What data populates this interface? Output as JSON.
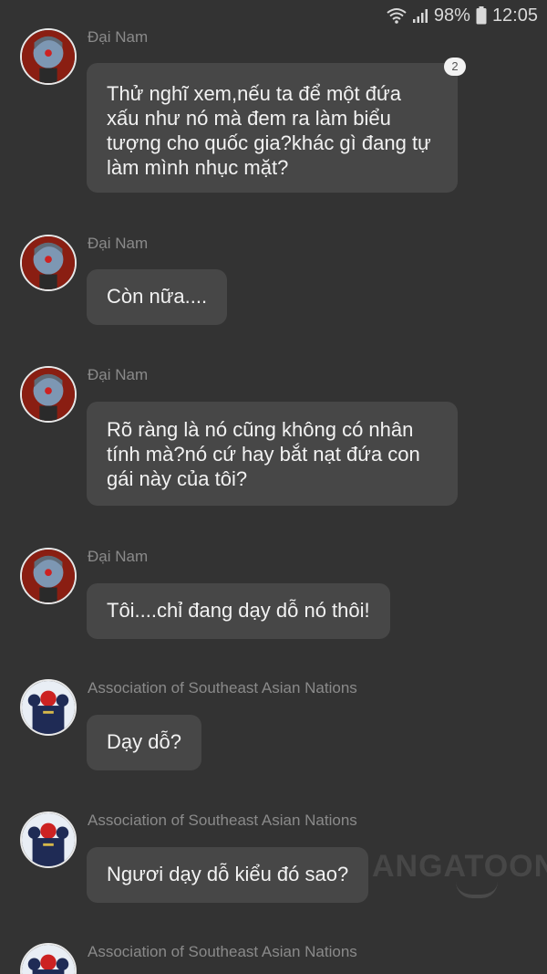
{
  "status_bar": {
    "battery": "98%",
    "time": "12:05",
    "wifi_icon": "wifi-icon",
    "signal_icon": "signal-icon",
    "battery_icon": "battery-icon"
  },
  "watermark": "ANGATOON",
  "messages": [
    {
      "sender": "Đại Nam",
      "avatar_icon": "dai-nam-avatar",
      "text": "Thử nghĩ xem,nếu ta để một đứa xấu như nó mà đem ra làm biểu tượng cho quốc gia?khác gì đang tự làm mình nhục mặt?",
      "badge": "2"
    },
    {
      "sender": "Đại Nam",
      "avatar_icon": "dai-nam-avatar",
      "text": "Còn nữa...."
    },
    {
      "sender": "Đại Nam",
      "avatar_icon": "dai-nam-avatar",
      "text": "Rõ ràng là nó cũng không có nhân tính mà?nó cứ hay bắt nạt đứa con gái này của tôi?"
    },
    {
      "sender": "Đại Nam",
      "avatar_icon": "dai-nam-avatar",
      "text": "Tôi....chỉ đang dạy dỗ nó thôi!"
    },
    {
      "sender": "Association of Southeast Asian Nations",
      "avatar_icon": "asean-avatar",
      "text": "Dạy dỗ?"
    },
    {
      "sender": "Association of Southeast Asian Nations",
      "avatar_icon": "asean-avatar",
      "text": "Ngươi dạy dỗ kiểu đó sao?"
    },
    {
      "sender": "Association of Southeast Asian Nations",
      "avatar_icon": "asean-avatar"
    }
  ]
}
